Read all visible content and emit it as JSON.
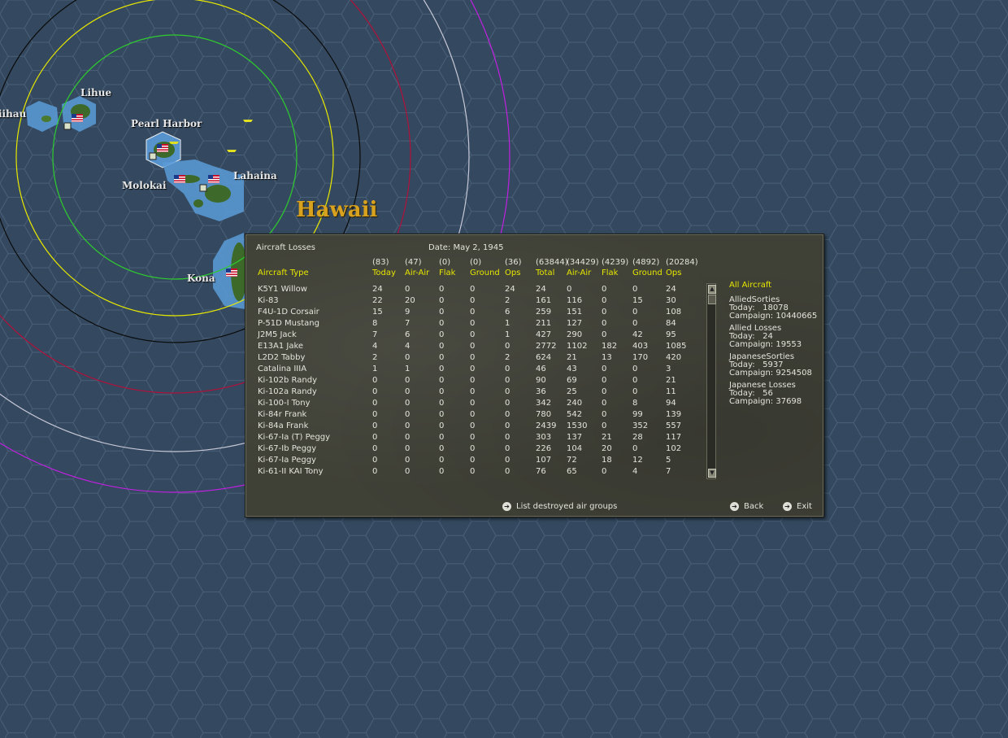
{
  "map": {
    "region_label": "Hawaii",
    "places": {
      "niihau": "iihau",
      "lihue": "Lihue",
      "pearl_harbor": "Pearl Harbor",
      "lahaina": "Lahaina",
      "molokai": "Molokai",
      "kona": "Kona"
    },
    "colors": {
      "ocean": "#34495f",
      "hex_line": "#4a6078",
      "land": "#2f5a28",
      "shallow": "#5a9bd8",
      "ring_green": "#2ecc2e",
      "ring_yellow": "#e8e800",
      "ring_black": "#0a0a0a",
      "ring_red": "#b0103a",
      "ring_white": "#c8c8d8",
      "ring_magenta": "#c020e0"
    }
  },
  "panel": {
    "title": "Aircraft Losses",
    "date_label": "Date: May 2, 1945",
    "header_totals": [
      "(83)",
      "(47)",
      "(0)",
      "(0)",
      "(36)",
      "(63844)",
      "(34429)",
      "(4239)",
      "(4892)",
      "(20284)"
    ],
    "columns": [
      "Aircraft Type",
      "Today",
      "Air-Air",
      "Flak",
      "Ground",
      "Ops",
      "Total",
      "Air-Air",
      "Flak",
      "Ground",
      "Ops"
    ],
    "rows": [
      [
        "K5Y1 Willow",
        "24",
        "0",
        "0",
        "0",
        "24",
        "24",
        "0",
        "0",
        "0",
        "24"
      ],
      [
        "Ki-83",
        "22",
        "20",
        "0",
        "0",
        "2",
        "161",
        "116",
        "0",
        "15",
        "30"
      ],
      [
        "F4U-1D Corsair",
        "15",
        "9",
        "0",
        "0",
        "6",
        "259",
        "151",
        "0",
        "0",
        "108"
      ],
      [
        "P-51D Mustang",
        "8",
        "7",
        "0",
        "0",
        "1",
        "211",
        "127",
        "0",
        "0",
        "84"
      ],
      [
        "J2M5 Jack",
        "7",
        "6",
        "0",
        "0",
        "1",
        "427",
        "290",
        "0",
        "42",
        "95"
      ],
      [
        "E13A1 Jake",
        "4",
        "4",
        "0",
        "0",
        "0",
        "2772",
        "1102",
        "182",
        "403",
        "1085"
      ],
      [
        "L2D2 Tabby",
        "2",
        "0",
        "0",
        "0",
        "2",
        "624",
        "21",
        "13",
        "170",
        "420"
      ],
      [
        "Catalina IIIA",
        "1",
        "1",
        "0",
        "0",
        "0",
        "46",
        "43",
        "0",
        "0",
        "3"
      ],
      [
        "Ki-102b Randy",
        "0",
        "0",
        "0",
        "0",
        "0",
        "90",
        "69",
        "0",
        "0",
        "21"
      ],
      [
        "Ki-102a Randy",
        "0",
        "0",
        "0",
        "0",
        "0",
        "36",
        "25",
        "0",
        "0",
        "11"
      ],
      [
        "Ki-100-I Tony",
        "0",
        "0",
        "0",
        "0",
        "0",
        "342",
        "240",
        "0",
        "8",
        "94"
      ],
      [
        "Ki-84r Frank",
        "0",
        "0",
        "0",
        "0",
        "0",
        "780",
        "542",
        "0",
        "99",
        "139"
      ],
      [
        "Ki-84a Frank",
        "0",
        "0",
        "0",
        "0",
        "0",
        "2439",
        "1530",
        "0",
        "352",
        "557"
      ],
      [
        "Ki-67-Ia (T) Peggy",
        "0",
        "0",
        "0",
        "0",
        "0",
        "303",
        "137",
        "21",
        "28",
        "117"
      ],
      [
        "Ki-67-Ib Peggy",
        "0",
        "0",
        "0",
        "0",
        "0",
        "226",
        "104",
        "20",
        "0",
        "102"
      ],
      [
        "Ki-67-Ia Peggy",
        "0",
        "0",
        "0",
        "0",
        "0",
        "107",
        "72",
        "18",
        "12",
        "5"
      ],
      [
        "Ki-61-II KAI Tony",
        "0",
        "0",
        "0",
        "0",
        "0",
        "76",
        "65",
        "0",
        "4",
        "7"
      ]
    ],
    "side": {
      "filter": "All Aircraft",
      "blocks": [
        {
          "heading": "AlliedSorties",
          "today": "Today:   18078",
          "campaign": "Campaign: 10440665"
        },
        {
          "heading": "Allied Losses",
          "today": "Today:   24",
          "campaign": "Campaign: 19553"
        },
        {
          "heading": "JapaneseSorties",
          "today": "Today:   5937",
          "campaign": "Campaign: 9254508"
        },
        {
          "heading": "Japanese Losses",
          "today": "Today:   56",
          "campaign": "Campaign: 37698"
        }
      ]
    },
    "buttons": {
      "list_destroyed": "List destroyed air groups",
      "back": "Back",
      "exit": "Exit"
    },
    "colors": {
      "header_text": "#e6e600",
      "body_text": "#e4e4dc",
      "panel_bg": "#3f4036"
    }
  }
}
